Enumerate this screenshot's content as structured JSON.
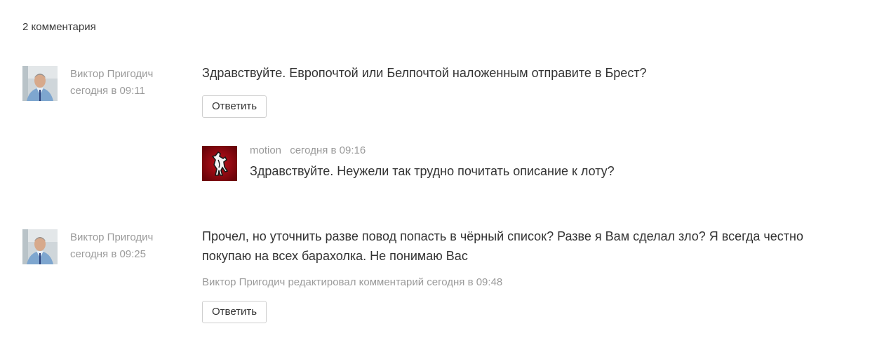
{
  "comments_count": "2 комментария",
  "comments": [
    {
      "author": "Виктор Пригодич",
      "time": "сегодня в 09:11",
      "text": "Здравствуйте. Европочтой или Белпочтой наложенным отправите в Брест?",
      "reply_label": "Ответить",
      "reply": {
        "author": "motion",
        "time": "сегодня в 09:16",
        "text": "Здравствуйте. Неужели так трудно почитать описание к лоту?"
      }
    },
    {
      "author": "Виктор Пригодич",
      "time": "сегодня в 09:25",
      "text": "Прочел, но уточнить разве повод попасть в чёрный список? Разве я Вам сделал зло? Я всегда честно покупаю на всех барахолка. Не понимаю Вас",
      "edited_note": "Виктор Пригодич редактировал комментарий сегодня в 09:48",
      "reply_label": "Ответить"
    }
  ],
  "colors": {
    "text": "#333333",
    "muted": "#9a9a9a",
    "button_border": "#cfcfcf",
    "reply_avatar_bg": "#8b0a12"
  },
  "icons": {
    "user_avatar": "person-photo-avatar",
    "reply_avatar": "prancing-horse-logo-avatar"
  }
}
